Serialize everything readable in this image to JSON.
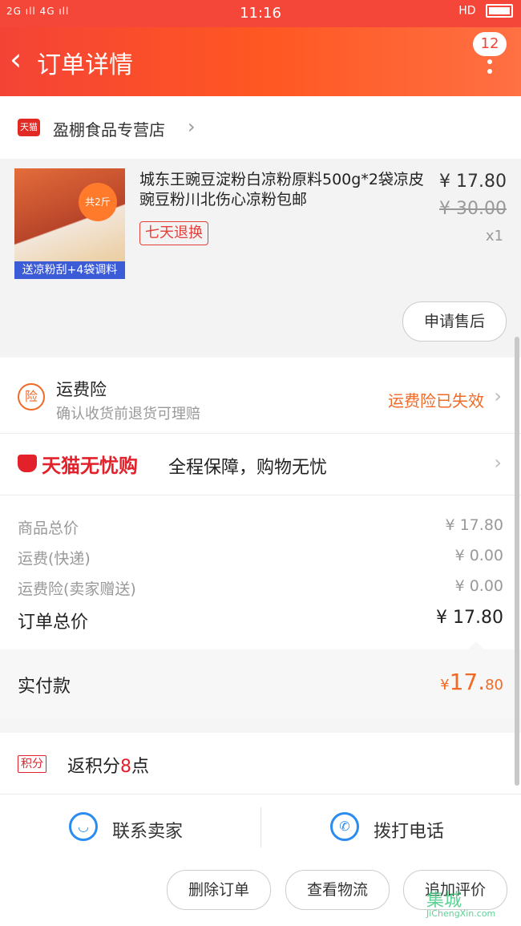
{
  "status_bar": {
    "left": "2G ıll 4G ıll",
    "time": "11:16",
    "right": "HD"
  },
  "header": {
    "back_icon": "‹",
    "title": "订单详情",
    "badge": "12"
  },
  "shop": {
    "badge": "天猫",
    "name": "盈棚食品专营店",
    "chevron": "›"
  },
  "product": {
    "thumb_pill": "共2斤",
    "thumb_banner": "送凉粉刮+4袋调料",
    "title": "城东王豌豆淀粉白凉粉原料500g*2袋凉皮豌豆粉川北伤心凉粉包邮",
    "return_tag": "七天退换",
    "price_now": "¥ 17.80",
    "price_old": "¥ 30.00",
    "quantity": "x1",
    "after_sale_label": "申请售后"
  },
  "insurance": {
    "icon": "险",
    "title": "运费险",
    "subtitle": "确认收货前退货可理赔",
    "status": "运费险已失效",
    "chevron": "›"
  },
  "worry_free": {
    "brand": "天猫无忧购",
    "desc": "全程保障，购物无忧",
    "chevron": "›"
  },
  "summary": {
    "rows": [
      {
        "label": "商品总价",
        "value": "¥ 17.80"
      },
      {
        "label": "运费(快递)",
        "value": "¥ 0.00"
      },
      {
        "label": "运费险(卖家赠送)",
        "value": "¥ 0.00"
      }
    ],
    "total_label": "订单总价",
    "total_value": "¥ 17.80"
  },
  "paid": {
    "label": "实付款",
    "symbol": "¥",
    "value_main": "17.",
    "value_cents": "80"
  },
  "points": {
    "tag": "积分",
    "prefix": "返积分",
    "number": "8",
    "suffix": "点"
  },
  "contact": {
    "seller_label": "联系卖家",
    "phone_label": "拨打电话"
  },
  "actions": {
    "delete_label": "删除订单",
    "logistics_label": "查看物流",
    "review_label": "追加评价"
  },
  "watermark": {
    "line1": "集城",
    "line2": "JiChengXin.com"
  },
  "colors": {
    "brand_red": "#f44336",
    "accent_orange": "#f06a25",
    "tmall_red": "#e2212b",
    "link_blue": "#2a8cf0"
  }
}
